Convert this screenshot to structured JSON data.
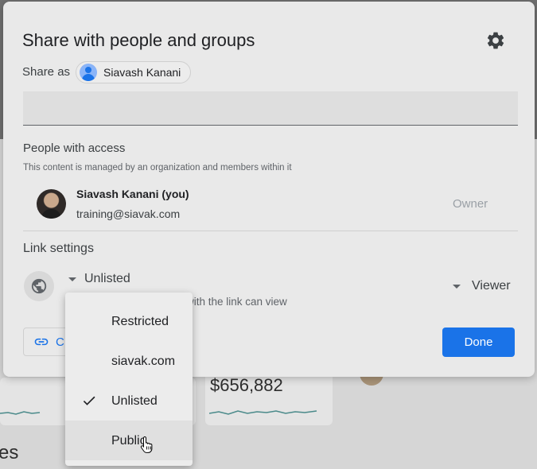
{
  "background": {
    "price": "$656,882",
    "partial_text": "es"
  },
  "dialog": {
    "title": "Share with people and groups",
    "share_as": {
      "label": "Share as",
      "name": "Siavash Kanani"
    },
    "people_section": {
      "heading": "People with access",
      "note": "This content is managed by an organization and members within it",
      "people": [
        {
          "name": "Siavash Kanani (you)",
          "email": "training@siavak.com",
          "role": "Owner"
        }
      ]
    },
    "link_section": {
      "heading": "Link settings",
      "access_value": "Unlisted",
      "access_description_visible": "with the link can view",
      "role_value": "Viewer"
    },
    "copy_link_label_visible": "C",
    "done_label": "Done"
  },
  "access_dropdown": {
    "options": [
      {
        "label": "Restricted",
        "selected": false
      },
      {
        "label": "siavak.com",
        "selected": false
      },
      {
        "label": "Unlisted",
        "selected": true
      },
      {
        "label": "Public",
        "selected": false,
        "hovered": true
      }
    ]
  },
  "colors": {
    "accent": "#1a73e8",
    "dialog_bg": "#e9e9e9",
    "muted_text": "#9aa0a6"
  }
}
